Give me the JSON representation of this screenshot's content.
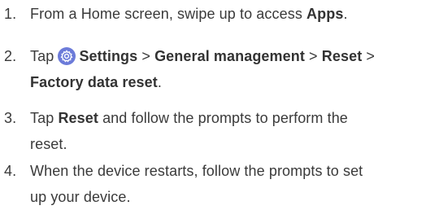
{
  "steps": [
    {
      "number": "1.",
      "pre": "From a Home screen, swipe up to access ",
      "bold": "Apps",
      "post": "."
    },
    {
      "number": "2.",
      "tap": "Tap ",
      "settings": "Settings",
      "sep1": " > ",
      "general": "General management",
      "sep2": " > ",
      "reset": "Reset",
      "sep3": " >",
      "factory": "Factory data reset",
      "post": ".",
      "icon": "settings-gear-icon",
      "icon_color": "#6c7bd9"
    },
    {
      "number": "3.",
      "pre": "Tap ",
      "bold": "Reset",
      "line1_post": " and follow the prompts to perform the",
      "line2": "reset."
    },
    {
      "number": "4.",
      "line1": "When the device restarts, follow the prompts to set",
      "line2": "up your device."
    }
  ]
}
